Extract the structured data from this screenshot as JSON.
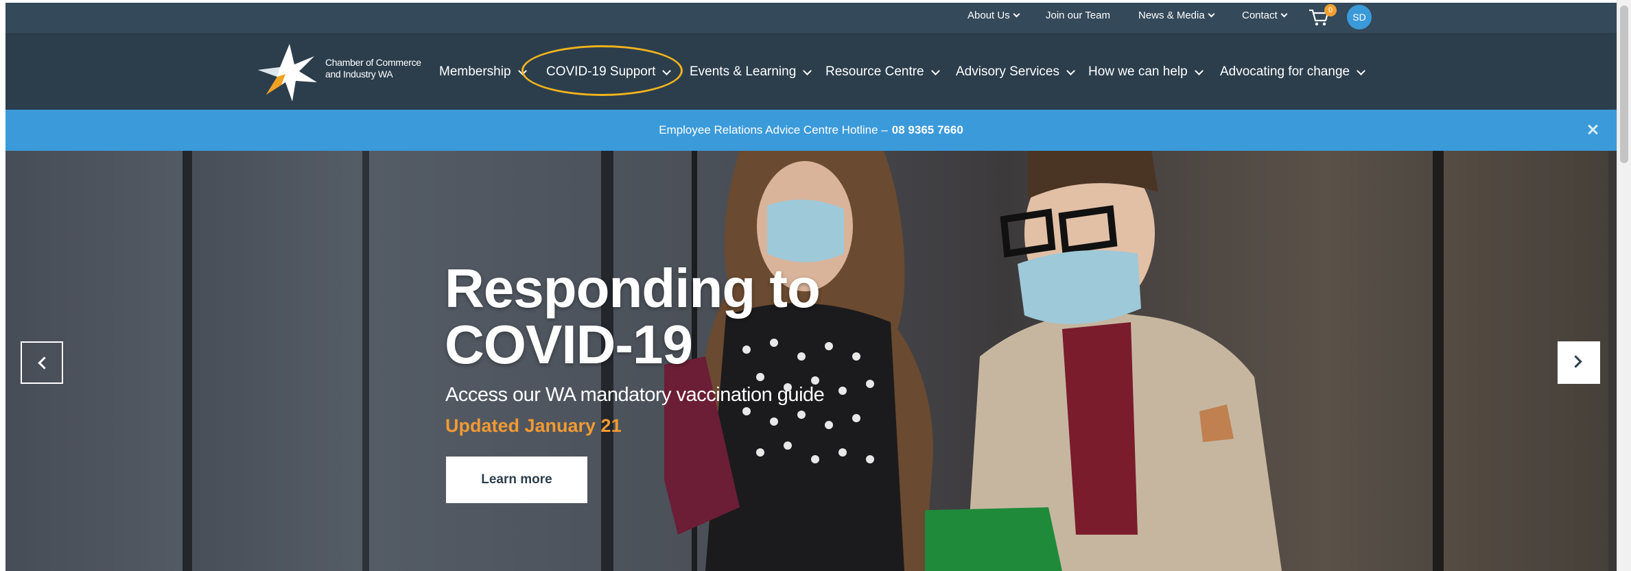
{
  "colors": {
    "nav_bg": "#2c3e4c",
    "hotline_bg": "#3b9ad9",
    "highlight_ring": "#f2b31b",
    "updated_text": "#f29a32",
    "cart_badge": "#f0a030"
  },
  "utility_nav": {
    "items": [
      {
        "label": "About Us",
        "dropdown": true
      },
      {
        "label": "Join our Team",
        "dropdown": false
      },
      {
        "label": "News & Media",
        "dropdown": true
      },
      {
        "label": "Contact",
        "dropdown": true
      }
    ],
    "cart_icon": "shopping-cart-icon",
    "cart_count": "0",
    "user_initials": "SD"
  },
  "brand": {
    "logo_icon": "star-logo-icon",
    "name_line1": "Chamber of Commerce",
    "name_line2": "and Industry WA"
  },
  "main_nav": {
    "items": [
      {
        "label": "Membership"
      },
      {
        "label": "COVID-19 Support",
        "highlighted": true
      },
      {
        "label": "Events & Learning"
      },
      {
        "label": "Resource Centre"
      },
      {
        "label": "Advisory Services"
      },
      {
        "label": "How we can help"
      },
      {
        "label": "Advocating for change"
      }
    ]
  },
  "hotline": {
    "text": "Employee Relations Advice Centre Hotline –",
    "phone": "08 9365 7660",
    "close_icon": "close-icon"
  },
  "hero": {
    "title_line1": "Responding to",
    "title_line2": "COVID-19",
    "subtitle": "Access our WA mandatory vaccination guide",
    "updated": "Updated January 21",
    "button_label": "Learn more",
    "prev_icon": "chevron-left-icon",
    "next_icon": "chevron-right-icon"
  }
}
